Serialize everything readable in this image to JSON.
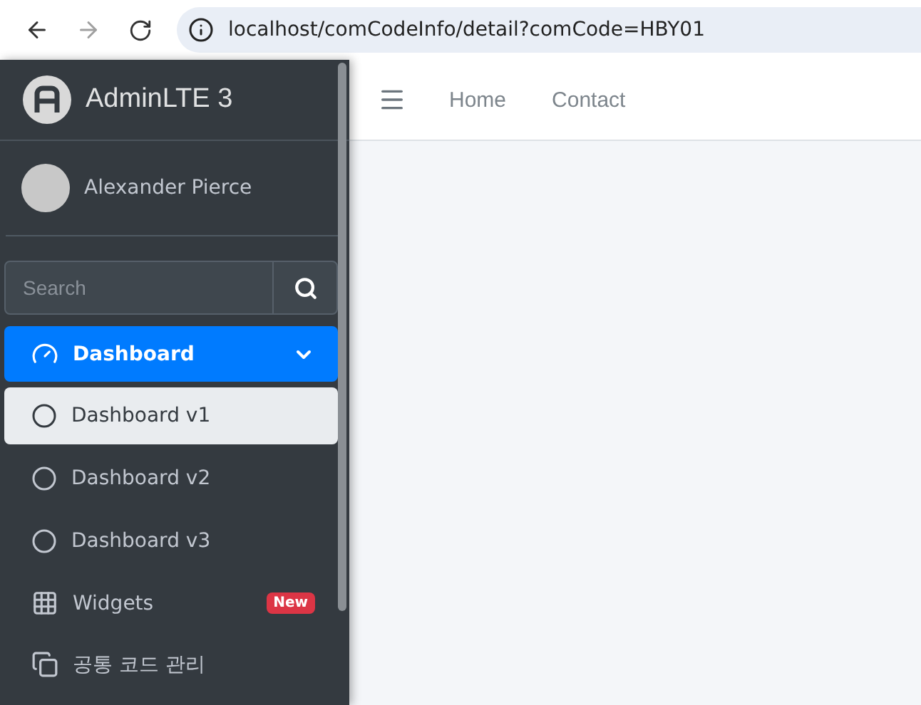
{
  "browser": {
    "url": "localhost/comCodeInfo/detail?comCode=HBY01",
    "forward_disabled": true
  },
  "brand": {
    "title": "AdminLTE 3"
  },
  "user": {
    "name": "Alexander Pierce"
  },
  "search": {
    "placeholder": "Search"
  },
  "nav": [
    {
      "label": "Dashboard",
      "selected": true,
      "expanded": true,
      "children": [
        {
          "label": "Dashboard v1",
          "selected": true
        },
        {
          "label": "Dashboard v2",
          "selected": false
        },
        {
          "label": "Dashboard v3",
          "selected": false
        }
      ]
    },
    {
      "label": "Widgets",
      "selected": false,
      "badge": "New"
    },
    {
      "label": "공통 코드 관리",
      "selected": false
    }
  ],
  "navbar": {
    "links": [
      "Home",
      "Contact"
    ]
  }
}
